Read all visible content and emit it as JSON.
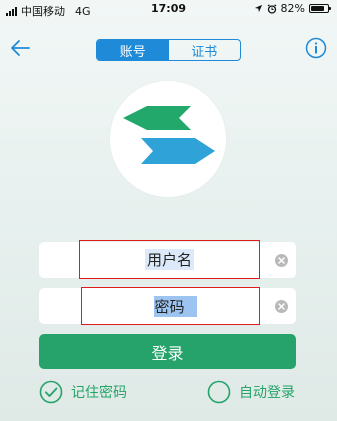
{
  "status_bar": {
    "carrier": "中国移动",
    "network": "4G",
    "time": "17:09",
    "battery_text": "82%",
    "battery_level": 0.82,
    "icons": [
      "signal-icon",
      "location-icon",
      "alarm-icon",
      "battery-icon"
    ]
  },
  "nav": {
    "back_icon": "back-arrow-icon",
    "tabs": [
      {
        "label": "账号",
        "active": true
      },
      {
        "label": "证书",
        "active": false
      }
    ],
    "info_icon": "info-icon"
  },
  "logo": {
    "icon": "app-logo-icon",
    "colors": {
      "green": "#22a86a",
      "blue": "#2fa2d8"
    }
  },
  "form": {
    "username_placeholder": "用户名",
    "password_placeholder": "密码",
    "clear_icon": "clear-icon",
    "login_label": "登录"
  },
  "options": {
    "remember_label": "记住密码",
    "remember_checked": true,
    "auto_login_label": "自动登录",
    "auto_login_checked": false
  },
  "colors": {
    "accent_blue": "#1e8ad8",
    "brand_green": "#25a36a",
    "highlight_red": "#e01b1b"
  }
}
